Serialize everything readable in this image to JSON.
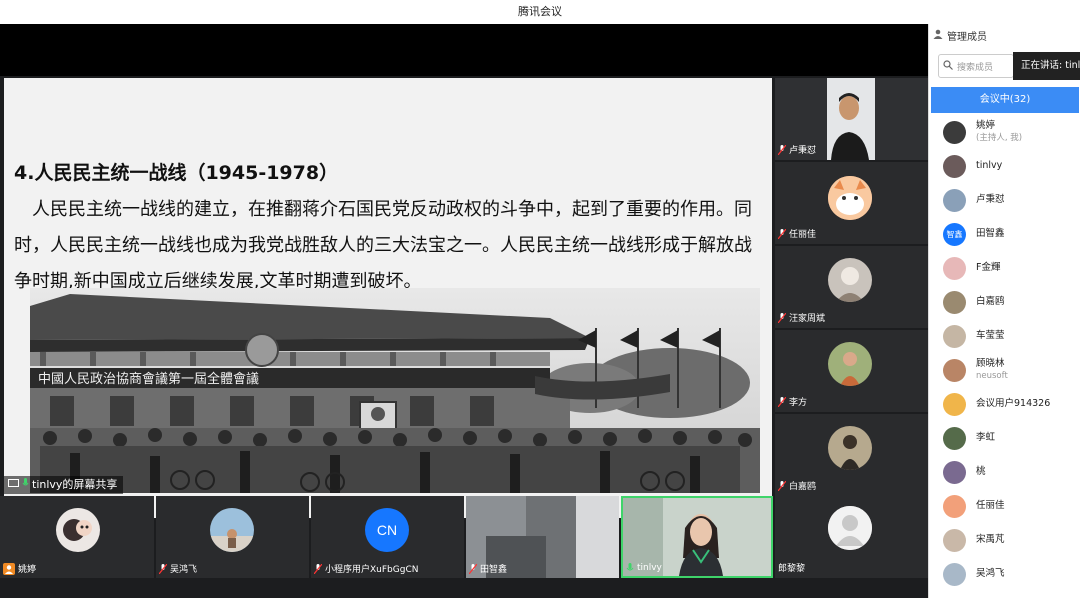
{
  "window": {
    "title": "腾讯会议"
  },
  "slide": {
    "heading": "4.人民民主统一战线（1945-1978）",
    "body": "人民民主统一战线的建立，在推翻蒋介石国民党反动政权的斗争中，起到了重要的作用。同时，人民民主统一战线也成为我党战胜敌人的三大法宝之一。人民民主统一战线形成于解放战争时期,新中国成立后继续发展,文革时期遭到破坏。",
    "photo_sign": "中國人民政治協商會議第一屆全體會議"
  },
  "screen_share": {
    "label": "tinlvy的屏幕共享"
  },
  "right_tiles": [
    {
      "name": "卢秉怼"
    },
    {
      "name": "任丽佳"
    },
    {
      "name": "汪家周斌"
    },
    {
      "name": "李方"
    },
    {
      "name": "白嘉鸥"
    },
    {
      "name": "郎黎黎"
    }
  ],
  "bottom_tiles": [
    {
      "name": "姚婷"
    },
    {
      "name": "吴鸿飞"
    },
    {
      "name": "小程序用户XuFbGgCN",
      "initials": "CN"
    },
    {
      "name": "田智鑫"
    },
    {
      "name": "tinlvy"
    }
  ],
  "panel": {
    "title": "管理成员",
    "search_placeholder": "搜索成员",
    "speaking": "正在讲话: tinlvy",
    "tab": "会议中(32)",
    "members": [
      {
        "name": "姚婷",
        "sub": "(主持人, 我)"
      },
      {
        "name": "tinlvy"
      },
      {
        "name": "卢秉怼"
      },
      {
        "name": "田智鑫",
        "avatar_text": "智鑫"
      },
      {
        "name": "F金輝"
      },
      {
        "name": "白嘉鸥"
      },
      {
        "name": "车莹莹"
      },
      {
        "name": "顾晓林",
        "sub": "neusoft"
      },
      {
        "name": "会议用户914326"
      },
      {
        "name": "李虹"
      },
      {
        "name": "桃"
      },
      {
        "name": "任丽佳"
      },
      {
        "name": "宋禹芃"
      },
      {
        "name": "吴鸿飞"
      }
    ]
  },
  "colors": {
    "accent": "#3b8cf5",
    "stage": "#1c1d1f",
    "host_badge": "#f08a24"
  }
}
